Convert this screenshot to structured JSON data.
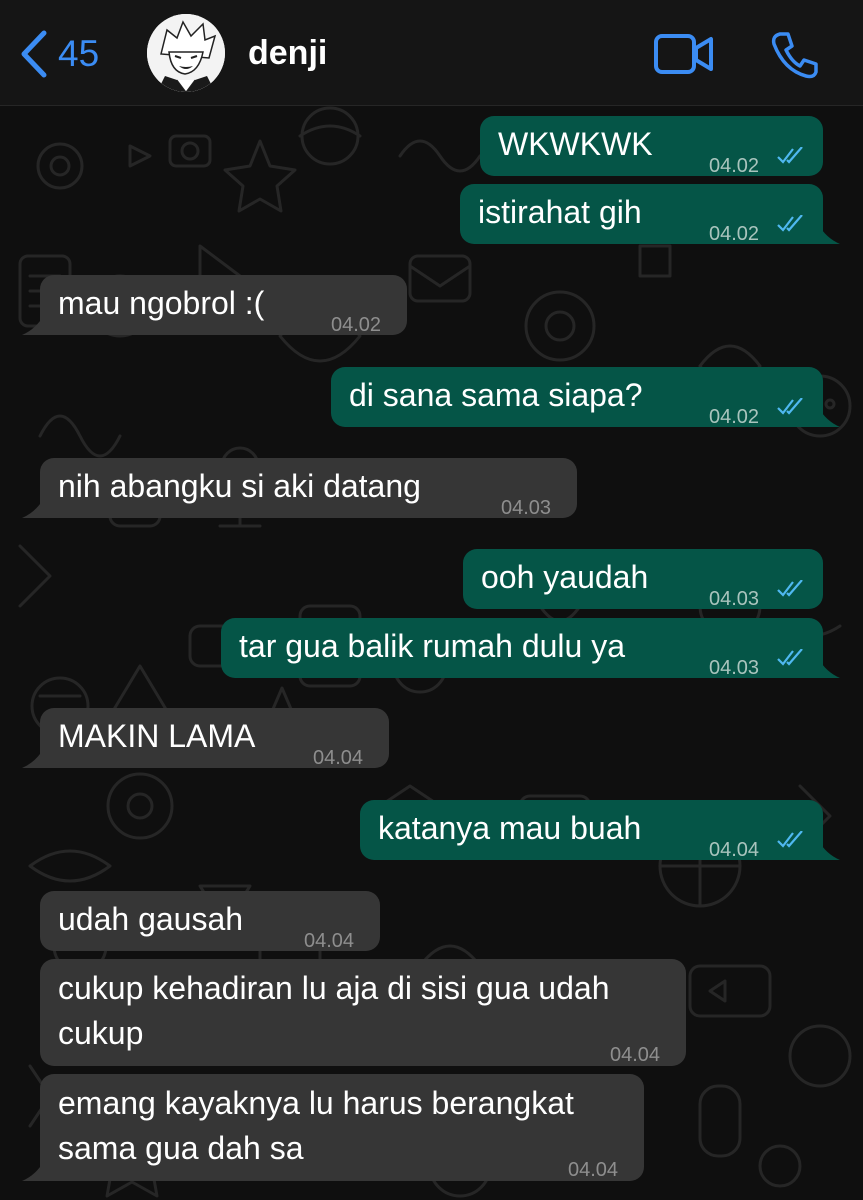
{
  "header": {
    "back_count": "45",
    "contact_name": "denji",
    "accent_color": "#3b8cf3",
    "icons": [
      "chevron-left-icon",
      "video-call-icon",
      "phone-call-icon"
    ]
  },
  "messages": [
    {
      "direction": "outgoing",
      "text": "WKWKWK",
      "time": "04.02",
      "status": "read"
    },
    {
      "direction": "outgoing",
      "text": "istirahat gih",
      "time": "04.02",
      "status": "read"
    },
    {
      "direction": "incoming",
      "text": "mau ngobrol :(",
      "time": "04.02"
    },
    {
      "direction": "outgoing",
      "text": "di sana sama siapa?",
      "time": "04.02",
      "status": "read"
    },
    {
      "direction": "incoming",
      "text": "nih abangku si aki datang",
      "time": "04.03"
    },
    {
      "direction": "outgoing",
      "text": "ooh yaudah",
      "time": "04.03",
      "status": "read"
    },
    {
      "direction": "outgoing",
      "text": "tar gua balik rumah dulu ya",
      "time": "04.03",
      "status": "read"
    },
    {
      "direction": "incoming",
      "text": "MAKIN LAMA",
      "time": "04.04"
    },
    {
      "direction": "outgoing",
      "text": "katanya mau buah",
      "time": "04.04",
      "status": "read"
    },
    {
      "direction": "incoming",
      "text": "udah gausah",
      "time": "04.04"
    },
    {
      "direction": "incoming",
      "lines": [
        "cukup kehadiran lu aja di sisi gua udah",
        "cukup"
      ],
      "time": "04.04"
    },
    {
      "direction": "incoming",
      "lines": [
        "emang kayaknya lu harus berangkat",
        "sama gua dah sa"
      ],
      "time": "04.04"
    }
  ],
  "colors": {
    "outgoing_bubble": "#055547",
    "incoming_bubble": "#363636",
    "read_ticks": "#4fb8f0"
  }
}
